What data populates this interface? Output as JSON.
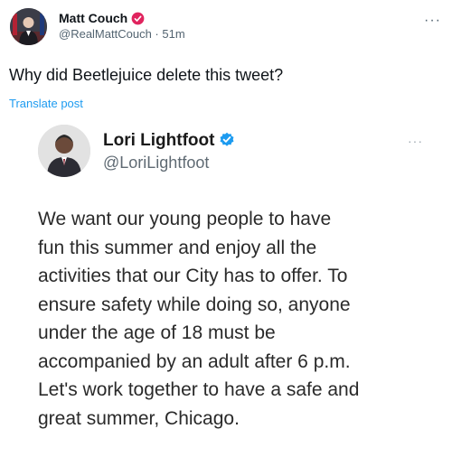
{
  "post": {
    "author_name": "Matt Couch",
    "handle": "@RealMattCouch",
    "separator": "·",
    "time": "51m",
    "more_label": "···",
    "text": "Why did Beetlejuice delete this tweet?",
    "translate_label": "Translate post",
    "avatar_icon": "user-avatar",
    "badge_icon": "verified-badge",
    "badge_color": "#e0245e"
  },
  "embedded_tweet": {
    "author_name": "Lori Lightfoot",
    "handle": "@LoriLightfoot",
    "more_label": "···",
    "badge_icon": "verified-badge",
    "badge_color": "#1d9bf0",
    "body_lines": [
      "We want our young people to have",
      "fun this summer and enjoy all the",
      "activities that our City has to offer. To",
      "ensure safety while doing so, anyone",
      "under the age of 18 must be",
      "accompanied by an adult after 6 p.m.",
      "Let's work together to have a safe and",
      "great summer, Chicago."
    ]
  },
  "colors": {
    "text_primary": "#0f1419",
    "text_secondary": "#536471",
    "link": "#1d9bf0"
  }
}
